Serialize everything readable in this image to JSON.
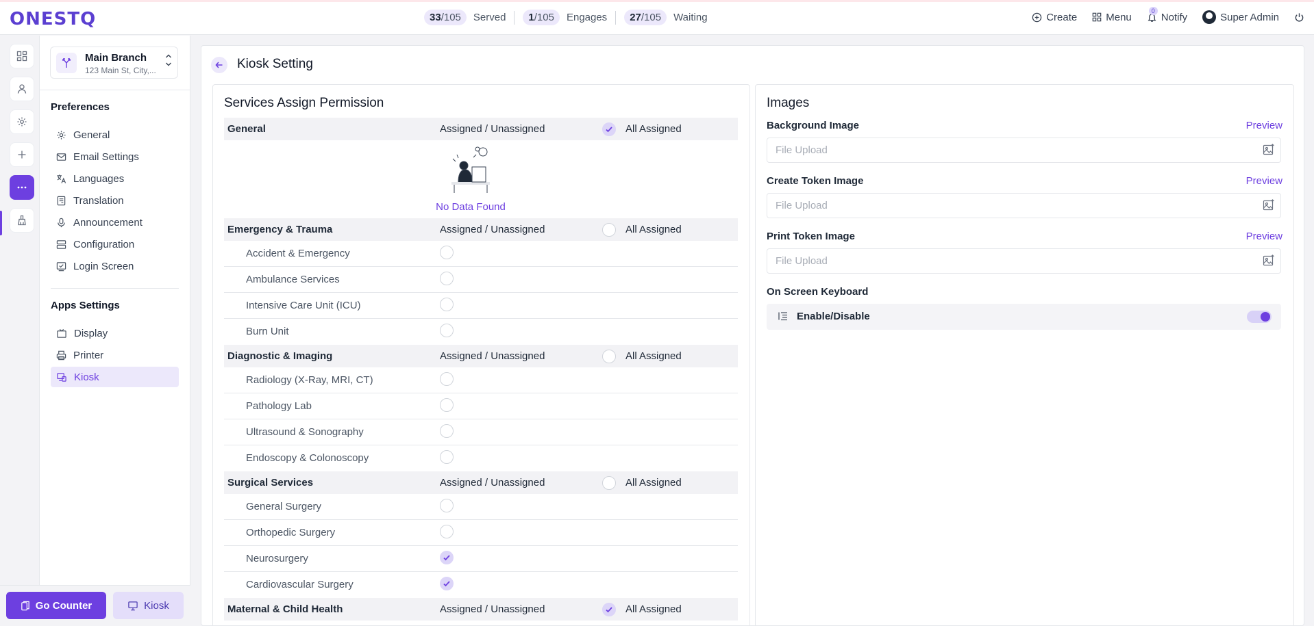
{
  "app": {
    "logo": "ONESTQ"
  },
  "stats": [
    {
      "count": "33",
      "total": "/105",
      "label": "Served"
    },
    {
      "count": "1",
      "total": "/105",
      "label": "Engages"
    },
    {
      "count": "27",
      "total": "/105",
      "label": "Waiting"
    }
  ],
  "topbar": {
    "create": "Create",
    "menu": "Menu",
    "notify": "Notify",
    "notify_count": "0",
    "user": "Super Admin"
  },
  "branch": {
    "name": "Main Branch",
    "address": "123 Main St, City,..."
  },
  "sidebar": {
    "preferences_heading": "Preferences",
    "preferences": [
      {
        "label": "General",
        "icon": "gear-icon"
      },
      {
        "label": "Email Settings",
        "icon": "mail-icon"
      },
      {
        "label": "Languages",
        "icon": "translate-icon"
      },
      {
        "label": "Translation",
        "icon": "book-icon"
      },
      {
        "label": "Announcement",
        "icon": "microphone-icon"
      },
      {
        "label": "Configuration",
        "icon": "server-icon"
      },
      {
        "label": "Login Screen",
        "icon": "login-screen-icon"
      }
    ],
    "apps_heading": "Apps Settings",
    "apps": [
      {
        "label": "Display",
        "icon": "tv-icon"
      },
      {
        "label": "Printer",
        "icon": "printer-icon"
      },
      {
        "label": "Kiosk",
        "icon": "kiosk-icon"
      }
    ]
  },
  "bottom": {
    "go_counter": "Go Counter",
    "kiosk": "Kiosk"
  },
  "page": {
    "title": "Kiosk Setting"
  },
  "services": {
    "title": "Services Assign Permission",
    "assign_label": "Assigned / Unassigned",
    "all_label": "All Assigned",
    "no_data": "No Data Found",
    "groups": [
      {
        "name": "General",
        "all_assigned": true,
        "items": []
      },
      {
        "name": "Emergency & Trauma",
        "all_assigned": false,
        "items": [
          {
            "name": "Accident & Emergency",
            "assigned": false
          },
          {
            "name": "Ambulance Services",
            "assigned": false
          },
          {
            "name": "Intensive Care Unit (ICU)",
            "assigned": false
          },
          {
            "name": "Burn Unit",
            "assigned": false
          }
        ]
      },
      {
        "name": "Diagnostic & Imaging",
        "all_assigned": false,
        "items": [
          {
            "name": "Radiology (X-Ray, MRI, CT)",
            "assigned": false
          },
          {
            "name": "Pathology Lab",
            "assigned": false
          },
          {
            "name": "Ultrasound & Sonography",
            "assigned": false
          },
          {
            "name": "Endoscopy & Colonoscopy",
            "assigned": false
          }
        ]
      },
      {
        "name": "Surgical Services",
        "all_assigned": false,
        "items": [
          {
            "name": "General Surgery",
            "assigned": false
          },
          {
            "name": "Orthopedic Surgery",
            "assigned": false
          },
          {
            "name": "Neurosurgery",
            "assigned": true
          },
          {
            "name": "Cardiovascular Surgery",
            "assigned": true
          }
        ]
      },
      {
        "name": "Maternal & Child Health",
        "all_assigned": true,
        "items": []
      }
    ]
  },
  "images": {
    "title": "Images",
    "preview": "Preview",
    "placeholder": "File Upload",
    "fields": [
      "Background Image",
      "Create Token Image",
      "Print Token Image"
    ],
    "keyboard_heading": "On Screen Keyboard",
    "keyboard_toggle": "Enable/Disable",
    "keyboard_enabled": true
  },
  "colors": {
    "accent": "#6d3fe0",
    "accent_light": "#ece8fb"
  }
}
